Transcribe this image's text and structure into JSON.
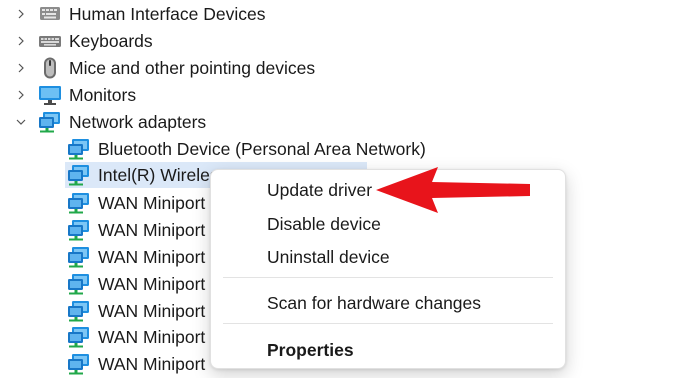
{
  "tree": {
    "categories": [
      {
        "label": "Human Interface Devices",
        "icon": "hid-icon"
      },
      {
        "label": "Keyboards",
        "icon": "keyboard-icon"
      },
      {
        "label": "Mice and other pointing devices",
        "icon": "mouse-icon"
      },
      {
        "label": "Monitors",
        "icon": "monitor-icon"
      },
      {
        "label": "Network adapters",
        "icon": "network-adapter-icon",
        "expanded": true
      }
    ],
    "network_adapters": [
      {
        "label": "Bluetooth Device (Personal Area Network)"
      },
      {
        "label": "Intel(R) Wireless",
        "selected": true
      },
      {
        "label": "WAN Miniport"
      },
      {
        "label": "WAN Miniport"
      },
      {
        "label": "WAN Miniport"
      },
      {
        "label": "WAN Miniport"
      },
      {
        "label": "WAN Miniport"
      },
      {
        "label": "WAN Miniport"
      },
      {
        "label": "WAN Miniport"
      }
    ]
  },
  "context_menu": {
    "update_driver": "Update driver",
    "disable_device": "Disable device",
    "uninstall_device": "Uninstall device",
    "scan_hardware": "Scan for hardware changes",
    "properties": "Properties"
  },
  "colors": {
    "selection": "#dbe8f8",
    "annotation_arrow": "#e8141b",
    "network_icon_blue": "#1e8fe0",
    "network_icon_green": "#21a84a"
  },
  "icons": {
    "collapsed": "chevron-right-icon",
    "expanded": "chevron-down-icon"
  }
}
